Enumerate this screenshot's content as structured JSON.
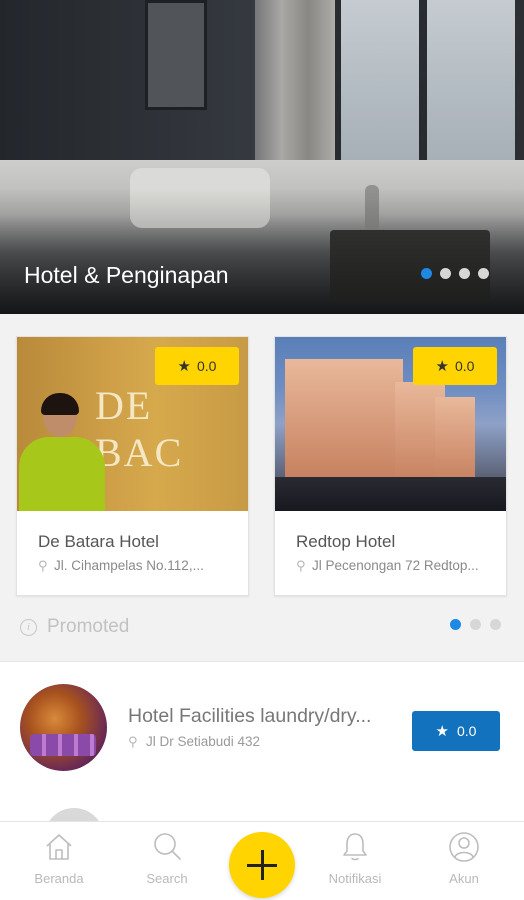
{
  "hero": {
    "title": "Hotel & Penginapan",
    "dots": 4,
    "active_dot": 0
  },
  "promo": {
    "cards": [
      {
        "name": "De Batara Hotel",
        "address": "Jl. Cihampelas No.112,...",
        "rating": "0.0",
        "image_text": "DE BAC"
      },
      {
        "name": "Redtop Hotel",
        "address": "Jl Pecenongan 72 Redtop...",
        "rating": "0.0"
      }
    ],
    "label": "Promoted",
    "dots": 3,
    "active_dot": 0
  },
  "list": {
    "items": [
      {
        "title": "Hotel Facilities laundry/dry...",
        "address": "Jl Dr Setiabudi 432",
        "rating": "0.0"
      }
    ]
  },
  "nav": {
    "items": [
      {
        "label": "Beranda",
        "icon": "home-icon"
      },
      {
        "label": "Search",
        "icon": "search-icon"
      },
      {
        "label": "Notifikasi",
        "icon": "bell-icon"
      },
      {
        "label": "Akun",
        "icon": "account-icon"
      }
    ],
    "fab_icon": "plus-icon"
  },
  "colors": {
    "accent_yellow": "#ffd400",
    "accent_blue": "#1272bd",
    "dot_active": "#1e88e5"
  }
}
